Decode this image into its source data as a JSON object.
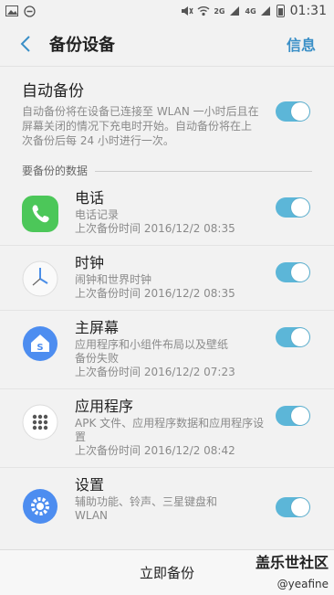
{
  "status_bar": {
    "network_label": "2G",
    "network_label2": "4G",
    "time": "01:31"
  },
  "header": {
    "title": "备份设备",
    "action": "信息"
  },
  "auto_backup": {
    "title": "自动备份",
    "description": "自动备份将在设备已连接至 WLAN 一小时后且在屏幕关闭的情况下充电时开始。自动备份将在上次备份后每 24 小时进行一次。",
    "enabled": true
  },
  "section": {
    "label": "要备份的数据"
  },
  "items": [
    {
      "title": "电话",
      "desc1": "电话记录",
      "desc2": "上次备份时间 2016/12/2 08:35",
      "icon": "phone-icon",
      "enabled": true
    },
    {
      "title": "时钟",
      "desc1": "闹钟和世界时钟",
      "desc2": "上次备份时间 2016/12/2 08:35",
      "icon": "clock-icon",
      "enabled": true
    },
    {
      "title": "主屏幕",
      "desc1": "应用程序和小组件布局以及壁纸",
      "desc1b": "备份失败",
      "desc2": "上次备份时间 2016/12/2 07:23",
      "icon": "home-screen-icon",
      "enabled": true
    },
    {
      "title": "应用程序",
      "desc1": "APK 文件、应用程序数据和应用程序设置",
      "desc2": "上次备份时间 2016/12/2 08:42",
      "icon": "apps-icon",
      "enabled": true
    },
    {
      "title": "设置",
      "desc1": "辅助功能、铃声、三星键盘和",
      "desc1b": "WLAN",
      "icon": "settings-icon",
      "enabled": true
    }
  ],
  "bottom": {
    "backup_now": "立即备份"
  },
  "watermark": {
    "line1": "盖乐世社区",
    "line2": "@yeafine"
  },
  "colors": {
    "accent": "#3a8fc7",
    "toggle_on": "#5cb6d8",
    "phone_green": "#4cc759",
    "home_blue": "#4d8df0"
  }
}
